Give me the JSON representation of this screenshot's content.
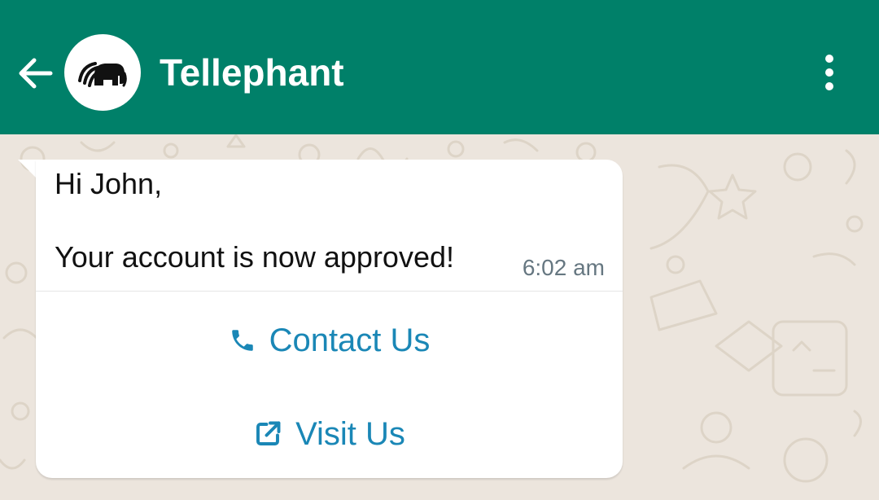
{
  "header": {
    "title": "Tellephant",
    "back_icon": "arrow-left-icon",
    "avatar_icon": "elephant-logo-icon",
    "menu_icon": "more-vert-icon",
    "color": "#008069"
  },
  "message": {
    "greeting": "Hi John,",
    "body": "Your account is now approved!",
    "time": "6:02 am"
  },
  "actions": [
    {
      "label": "Contact Us",
      "icon": "phone-icon"
    },
    {
      "label": "Visit Us",
      "icon": "external-link-icon"
    }
  ],
  "colors": {
    "chat_background": "#ece5dd",
    "bubble": "#ffffff",
    "action_text": "#1a87b6",
    "time_text": "#667781"
  }
}
